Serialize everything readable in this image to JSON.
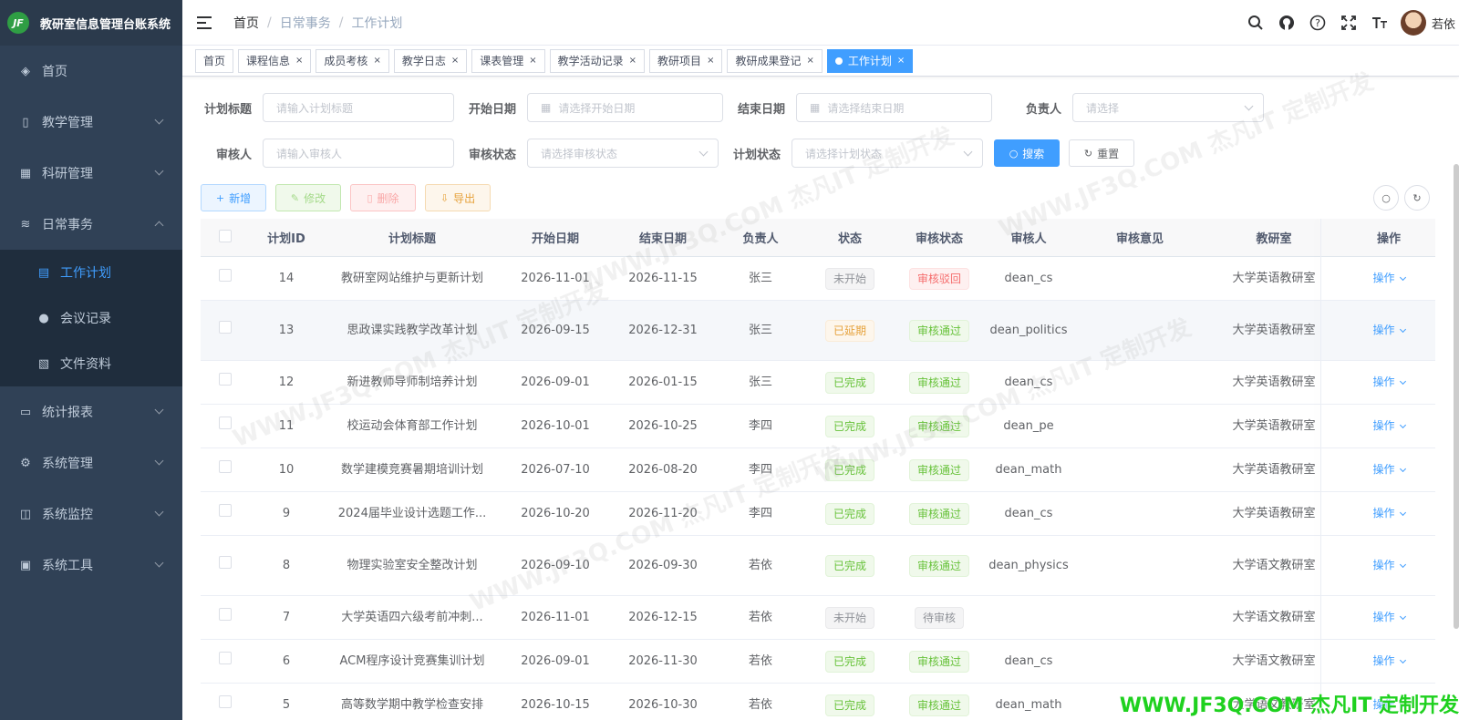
{
  "app": {
    "title": "教研室信息管理台账系统",
    "logo_text": "JF"
  },
  "sidebar": {
    "items": [
      {
        "label": "首页",
        "icon": "dashboard-icon",
        "glyph": "◈"
      },
      {
        "label": "教学管理",
        "icon": "book-icon",
        "glyph": "▯"
      },
      {
        "label": "科研管理",
        "icon": "table-icon",
        "glyph": "▦"
      },
      {
        "label": "日常事务",
        "icon": "layers-icon",
        "glyph": "≋"
      },
      {
        "label": "统计报表",
        "icon": "monitor-icon",
        "glyph": "▭"
      },
      {
        "label": "系统管理",
        "icon": "gear-icon",
        "glyph": "⚙"
      },
      {
        "label": "系统监控",
        "icon": "chart-monitor-icon",
        "glyph": "◫"
      },
      {
        "label": "系统工具",
        "icon": "toolbox-icon",
        "glyph": "▣"
      }
    ],
    "subitems": [
      {
        "label": "工作计划",
        "icon": "plan-icon",
        "glyph": "▤"
      },
      {
        "label": "会议记录",
        "icon": "people-icon",
        "glyph": "●"
      },
      {
        "label": "文件资料",
        "icon": "document-icon",
        "glyph": "▧"
      }
    ]
  },
  "breadcrumb": [
    "首页",
    "日常事务",
    "工作计划"
  ],
  "user": {
    "name": "若依"
  },
  "tags": [
    "首页",
    "课程信息",
    "成员考核",
    "教学日志",
    "课表管理",
    "教学活动记录",
    "教研项目",
    "教研成果登记",
    "工作计划"
  ],
  "search": {
    "title_label": "计划标题",
    "title_placeholder": "请输入计划标题",
    "start_label": "开始日期",
    "start_placeholder": "请选择开始日期",
    "end_label": "结束日期",
    "end_placeholder": "请选择结束日期",
    "owner_label": "负责人",
    "owner_placeholder": "请选择",
    "reviewer_label": "审核人",
    "reviewer_placeholder": "请输入审核人",
    "review_status_label": "审核状态",
    "review_status_placeholder": "请选择审核状态",
    "plan_status_label": "计划状态",
    "plan_status_placeholder": "请选择计划状态",
    "search_button": "搜索",
    "reset_button": "重置"
  },
  "toolbar": {
    "add": "新增",
    "edit": "修改",
    "delete": "删除",
    "export": "导出"
  },
  "table": {
    "headers": [
      "计划ID",
      "计划标题",
      "开始日期",
      "结束日期",
      "负责人",
      "状态",
      "审核状态",
      "审核人",
      "审核意见",
      "教研室",
      "操作"
    ],
    "rows": [
      {
        "id": "14",
        "title": "教研室网站维护与更新计划",
        "start": "2026-11-01",
        "end": "2026-11-15",
        "owner": "张三",
        "status": "未开始",
        "status_type": "info",
        "review": "审核驳回",
        "review_type": "danger",
        "reviewer": "dean_cs",
        "opinion": "",
        "dept": "大学英语教研室",
        "op": "操作"
      },
      {
        "id": "13",
        "title": "思政课实践教学改革计划",
        "start": "2026-09-15",
        "end": "2026-12-31",
        "owner": "张三",
        "status": "已延期",
        "status_type": "warning",
        "review": "审核通过",
        "review_type": "success",
        "reviewer": "dean_politics",
        "opinion": "",
        "dept": "大学英语教研室",
        "op": "操作"
      },
      {
        "id": "12",
        "title": "新进教师导师制培养计划",
        "start": "2026-09-01",
        "end": "2026-01-15",
        "owner": "张三",
        "status": "已完成",
        "status_type": "success",
        "review": "审核通过",
        "review_type": "success",
        "reviewer": "dean_cs",
        "opinion": "",
        "dept": "大学英语教研室",
        "op": "操作"
      },
      {
        "id": "11",
        "title": "校运动会体育部工作计划",
        "start": "2026-10-01",
        "end": "2026-10-25",
        "owner": "李四",
        "status": "已完成",
        "status_type": "success",
        "review": "审核通过",
        "review_type": "success",
        "reviewer": "dean_pe",
        "opinion": "",
        "dept": "大学英语教研室",
        "op": "操作"
      },
      {
        "id": "10",
        "title": "数学建模竞赛暑期培训计划",
        "start": "2026-07-10",
        "end": "2026-08-20",
        "owner": "李四",
        "status": "已完成",
        "status_type": "success",
        "review": "审核通过",
        "review_type": "success",
        "reviewer": "dean_math",
        "opinion": "",
        "dept": "大学英语教研室",
        "op": "操作"
      },
      {
        "id": "9",
        "title": "2024届毕业设计选题工作...",
        "start": "2026-10-20",
        "end": "2026-11-20",
        "owner": "李四",
        "status": "已完成",
        "status_type": "success",
        "review": "审核通过",
        "review_type": "success",
        "reviewer": "dean_cs",
        "opinion": "",
        "dept": "大学英语教研室",
        "op": "操作"
      },
      {
        "id": "8",
        "title": "物理实验室安全整改计划",
        "start": "2026-09-10",
        "end": "2026-09-30",
        "owner": "若依",
        "status": "已完成",
        "status_type": "success",
        "review": "审核通过",
        "review_type": "success",
        "reviewer": "dean_physics",
        "opinion": "",
        "dept": "大学语文教研室",
        "op": "操作"
      },
      {
        "id": "7",
        "title": "大学英语四六级考前冲刺...",
        "start": "2026-11-01",
        "end": "2026-12-15",
        "owner": "若依",
        "status": "未开始",
        "status_type": "info",
        "review": "待审核",
        "review_type": "info",
        "reviewer": "",
        "opinion": "",
        "dept": "大学语文教研室",
        "op": "操作"
      },
      {
        "id": "6",
        "title": "ACM程序设计竞赛集训计划",
        "start": "2026-09-01",
        "end": "2026-11-30",
        "owner": "若依",
        "status": "已完成",
        "status_type": "success",
        "review": "审核通过",
        "review_type": "success",
        "reviewer": "dean_cs",
        "opinion": "",
        "dept": "大学语文教研室",
        "op": "操作"
      },
      {
        "id": "5",
        "title": "高等数学期中教学检查安排",
        "start": "2026-10-15",
        "end": "2026-10-30",
        "owner": "若依",
        "status": "已完成",
        "status_type": "success",
        "review": "审核通过",
        "review_type": "success",
        "reviewer": "dean_math",
        "opinion": "",
        "dept": "大学语文教研室",
        "op": "操作"
      }
    ]
  },
  "watermark": {
    "text": "WWW.JF3Q.COM 杰凡IT 定制开发"
  },
  "colors": {
    "sidebar_bg": "#304156",
    "primary": "#409eff",
    "success": "#67c23a",
    "warning": "#e6a23c",
    "danger": "#f56c6c",
    "watermark_footer": "#1fd11f"
  }
}
